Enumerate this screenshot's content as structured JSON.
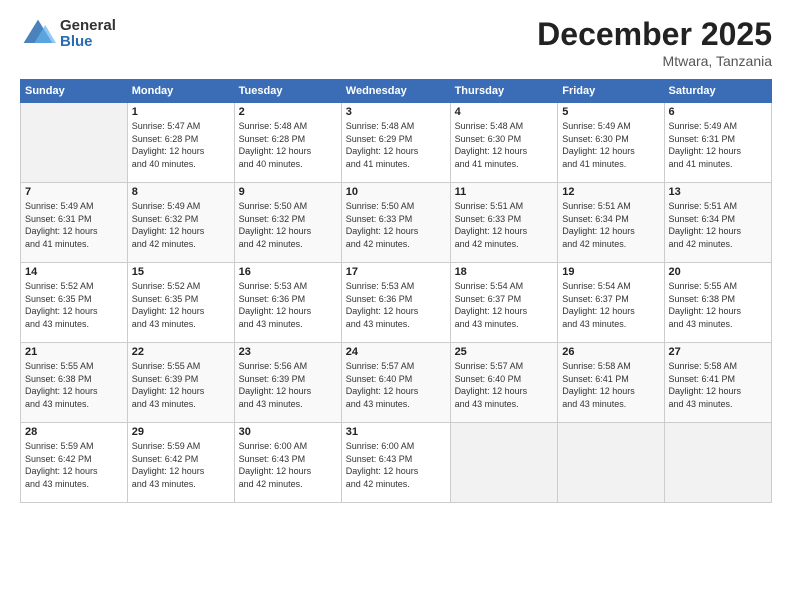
{
  "logo": {
    "general": "General",
    "blue": "Blue"
  },
  "title": "December 2025",
  "subtitle": "Mtwara, Tanzania",
  "days_header": [
    "Sunday",
    "Monday",
    "Tuesday",
    "Wednesday",
    "Thursday",
    "Friday",
    "Saturday"
  ],
  "weeks": [
    [
      {
        "num": "",
        "info": ""
      },
      {
        "num": "1",
        "info": "Sunrise: 5:47 AM\nSunset: 6:28 PM\nDaylight: 12 hours\nand 40 minutes."
      },
      {
        "num": "2",
        "info": "Sunrise: 5:48 AM\nSunset: 6:28 PM\nDaylight: 12 hours\nand 40 minutes."
      },
      {
        "num": "3",
        "info": "Sunrise: 5:48 AM\nSunset: 6:29 PM\nDaylight: 12 hours\nand 41 minutes."
      },
      {
        "num": "4",
        "info": "Sunrise: 5:48 AM\nSunset: 6:30 PM\nDaylight: 12 hours\nand 41 minutes."
      },
      {
        "num": "5",
        "info": "Sunrise: 5:49 AM\nSunset: 6:30 PM\nDaylight: 12 hours\nand 41 minutes."
      },
      {
        "num": "6",
        "info": "Sunrise: 5:49 AM\nSunset: 6:31 PM\nDaylight: 12 hours\nand 41 minutes."
      }
    ],
    [
      {
        "num": "7",
        "info": "Sunrise: 5:49 AM\nSunset: 6:31 PM\nDaylight: 12 hours\nand 41 minutes."
      },
      {
        "num": "8",
        "info": "Sunrise: 5:49 AM\nSunset: 6:32 PM\nDaylight: 12 hours\nand 42 minutes."
      },
      {
        "num": "9",
        "info": "Sunrise: 5:50 AM\nSunset: 6:32 PM\nDaylight: 12 hours\nand 42 minutes."
      },
      {
        "num": "10",
        "info": "Sunrise: 5:50 AM\nSunset: 6:33 PM\nDaylight: 12 hours\nand 42 minutes."
      },
      {
        "num": "11",
        "info": "Sunrise: 5:51 AM\nSunset: 6:33 PM\nDaylight: 12 hours\nand 42 minutes."
      },
      {
        "num": "12",
        "info": "Sunrise: 5:51 AM\nSunset: 6:34 PM\nDaylight: 12 hours\nand 42 minutes."
      },
      {
        "num": "13",
        "info": "Sunrise: 5:51 AM\nSunset: 6:34 PM\nDaylight: 12 hours\nand 42 minutes."
      }
    ],
    [
      {
        "num": "14",
        "info": "Sunrise: 5:52 AM\nSunset: 6:35 PM\nDaylight: 12 hours\nand 43 minutes."
      },
      {
        "num": "15",
        "info": "Sunrise: 5:52 AM\nSunset: 6:35 PM\nDaylight: 12 hours\nand 43 minutes."
      },
      {
        "num": "16",
        "info": "Sunrise: 5:53 AM\nSunset: 6:36 PM\nDaylight: 12 hours\nand 43 minutes."
      },
      {
        "num": "17",
        "info": "Sunrise: 5:53 AM\nSunset: 6:36 PM\nDaylight: 12 hours\nand 43 minutes."
      },
      {
        "num": "18",
        "info": "Sunrise: 5:54 AM\nSunset: 6:37 PM\nDaylight: 12 hours\nand 43 minutes."
      },
      {
        "num": "19",
        "info": "Sunrise: 5:54 AM\nSunset: 6:37 PM\nDaylight: 12 hours\nand 43 minutes."
      },
      {
        "num": "20",
        "info": "Sunrise: 5:55 AM\nSunset: 6:38 PM\nDaylight: 12 hours\nand 43 minutes."
      }
    ],
    [
      {
        "num": "21",
        "info": "Sunrise: 5:55 AM\nSunset: 6:38 PM\nDaylight: 12 hours\nand 43 minutes."
      },
      {
        "num": "22",
        "info": "Sunrise: 5:55 AM\nSunset: 6:39 PM\nDaylight: 12 hours\nand 43 minutes."
      },
      {
        "num": "23",
        "info": "Sunrise: 5:56 AM\nSunset: 6:39 PM\nDaylight: 12 hours\nand 43 minutes."
      },
      {
        "num": "24",
        "info": "Sunrise: 5:57 AM\nSunset: 6:40 PM\nDaylight: 12 hours\nand 43 minutes."
      },
      {
        "num": "25",
        "info": "Sunrise: 5:57 AM\nSunset: 6:40 PM\nDaylight: 12 hours\nand 43 minutes."
      },
      {
        "num": "26",
        "info": "Sunrise: 5:58 AM\nSunset: 6:41 PM\nDaylight: 12 hours\nand 43 minutes."
      },
      {
        "num": "27",
        "info": "Sunrise: 5:58 AM\nSunset: 6:41 PM\nDaylight: 12 hours\nand 43 minutes."
      }
    ],
    [
      {
        "num": "28",
        "info": "Sunrise: 5:59 AM\nSunset: 6:42 PM\nDaylight: 12 hours\nand 43 minutes."
      },
      {
        "num": "29",
        "info": "Sunrise: 5:59 AM\nSunset: 6:42 PM\nDaylight: 12 hours\nand 43 minutes."
      },
      {
        "num": "30",
        "info": "Sunrise: 6:00 AM\nSunset: 6:43 PM\nDaylight: 12 hours\nand 42 minutes."
      },
      {
        "num": "31",
        "info": "Sunrise: 6:00 AM\nSunset: 6:43 PM\nDaylight: 12 hours\nand 42 minutes."
      },
      {
        "num": "",
        "info": ""
      },
      {
        "num": "",
        "info": ""
      },
      {
        "num": "",
        "info": ""
      }
    ]
  ]
}
